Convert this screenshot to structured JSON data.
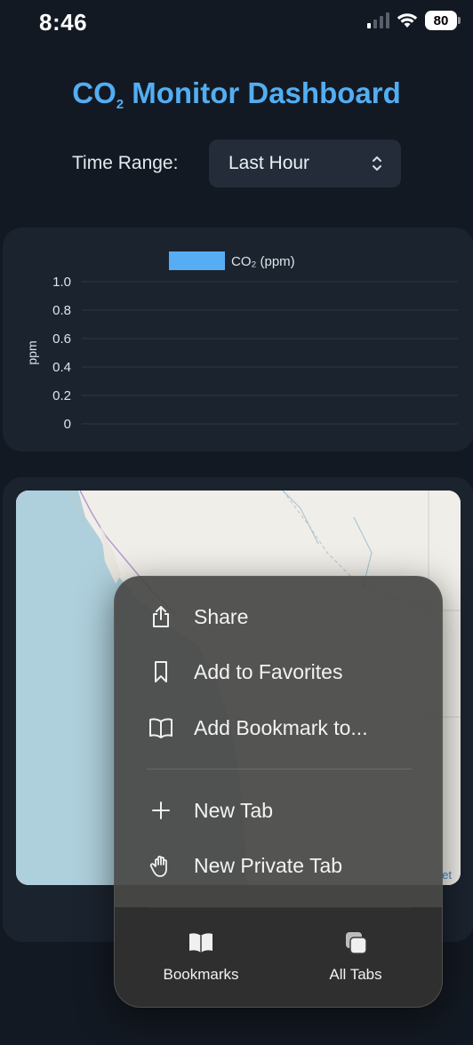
{
  "status_bar": {
    "time": "8:46",
    "battery": "80"
  },
  "header": {
    "title_prefix": "CO",
    "title_sub": "2",
    "title_suffix": " Monitor Dashboard"
  },
  "filter": {
    "label": "Time Range:",
    "selected": "Last Hour"
  },
  "chart_data": {
    "type": "line",
    "legend": [
      {
        "label": "CO₂ (ppm)",
        "color": "#57adf4"
      }
    ],
    "ylabel": "ppm",
    "xlabel": "",
    "ylim": [
      0,
      1.0
    ],
    "yticks": [
      "1.0",
      "0.8",
      "0.6",
      "0.4",
      "0.2",
      "0"
    ],
    "series": [
      {
        "name": "CO₂ (ppm)",
        "values": []
      }
    ],
    "grid": true
  },
  "map": {
    "attribution": "et"
  },
  "menu": {
    "items": [
      {
        "label": "Share",
        "icon": "share-icon"
      },
      {
        "label": "Add to Favorites",
        "icon": "bookmark-icon"
      },
      {
        "label": "Add Bookmark to...",
        "icon": "book-icon"
      },
      {
        "label": "New Tab",
        "icon": "plus-icon"
      },
      {
        "label": "New Private Tab",
        "icon": "hand-icon"
      }
    ],
    "bottom": [
      {
        "label": "Bookmarks",
        "icon": "book-filled-icon"
      },
      {
        "label": "All Tabs",
        "icon": "tabs-icon"
      }
    ]
  },
  "colors": {
    "accent": "#52aef3",
    "background": "#131922",
    "card": "#1b232e",
    "menu": "#484846"
  }
}
